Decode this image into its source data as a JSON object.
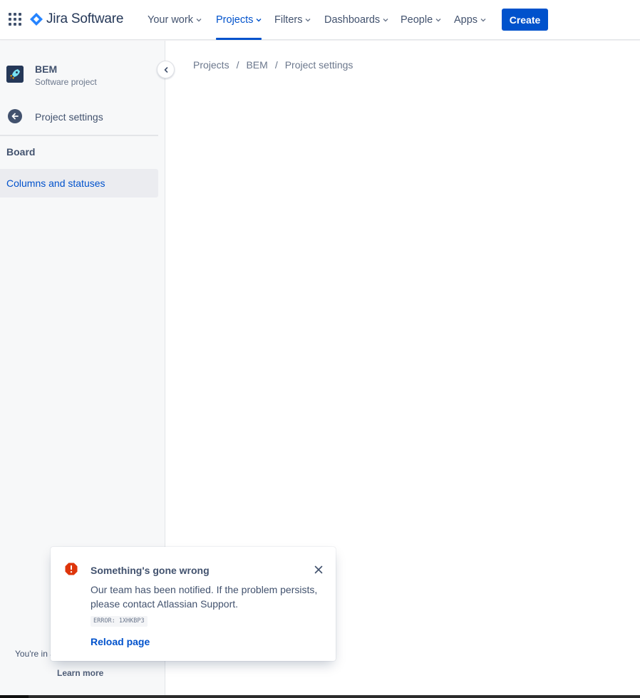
{
  "topnav": {
    "product_name": "Jira Software",
    "items": [
      {
        "label": "Your work",
        "active": false
      },
      {
        "label": "Projects",
        "active": true
      },
      {
        "label": "Filters",
        "active": false
      },
      {
        "label": "Dashboards",
        "active": false
      },
      {
        "label": "People",
        "active": false
      },
      {
        "label": "Apps",
        "active": false
      }
    ],
    "create_label": "Create"
  },
  "sidebar": {
    "project_name": "BEM",
    "project_type": "Software project",
    "back_label": "Project settings",
    "section_label": "Board",
    "items": [
      {
        "label": "Columns and statuses",
        "selected": true
      }
    ],
    "footer_text": "You're in a",
    "learn_more": "Learn more"
  },
  "breadcrumbs": [
    "Projects",
    "BEM",
    "Project settings"
  ],
  "flag": {
    "title": "Something's gone wrong",
    "description": "Our team has been notified. If the problem persists, please contact Atlassian Support.",
    "error_code": "ERROR: 1XHKBP3",
    "action_label": "Reload page"
  },
  "colors": {
    "brand_blue": "#0052cc",
    "error_red": "#de350b",
    "text_dark": "#42526e"
  }
}
